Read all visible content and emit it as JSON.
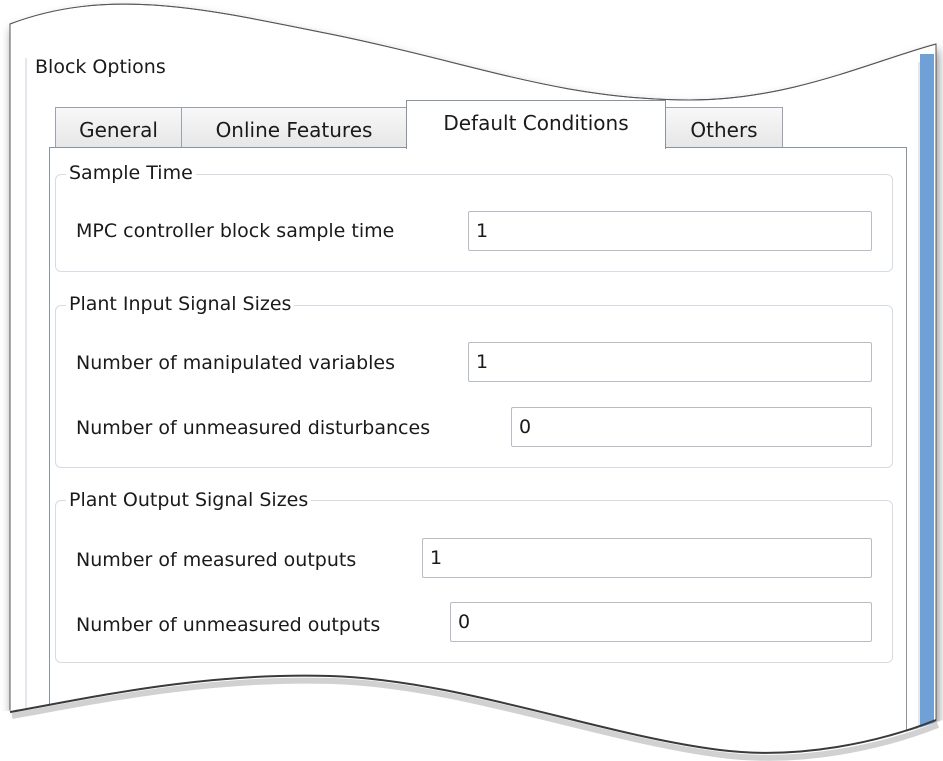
{
  "block_options": {
    "title": "Block Options",
    "tabs": [
      {
        "label": "General",
        "active": false
      },
      {
        "label": "Online Features",
        "active": false
      },
      {
        "label": "Default Conditions",
        "active": true
      },
      {
        "label": "Others",
        "active": false
      }
    ],
    "sample_time": {
      "legend": "Sample Time",
      "block_sample_time": {
        "label": "MPC controller block sample time",
        "value": "1"
      }
    },
    "plant_input": {
      "legend": "Plant Input Signal Sizes",
      "manipulated_variables": {
        "label": "Number of manipulated variables",
        "value": "1"
      },
      "unmeasured_disturbances": {
        "label": "Number of unmeasured disturbances",
        "value": "0"
      }
    },
    "plant_output": {
      "legend": "Plant Output Signal Sizes",
      "measured_outputs": {
        "label": "Number of measured outputs",
        "value": "1"
      },
      "unmeasured_outputs": {
        "label": "Number of unmeasured outputs",
        "value": "0"
      }
    }
  },
  "colors": {
    "scroll_accent": "#6fa0d6",
    "tab_border": "#8a949e",
    "group_border": "#d5dce4"
  }
}
